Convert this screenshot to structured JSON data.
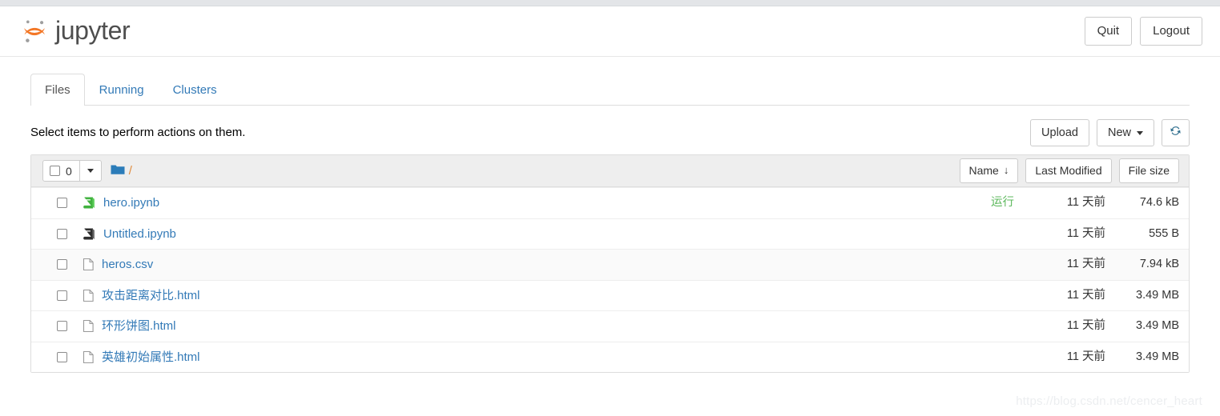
{
  "header": {
    "brand": "jupyter",
    "logo_icon": "jupyter-logo-icon",
    "quit_label": "Quit",
    "logout_label": "Logout"
  },
  "tabs": [
    {
      "label": "Files",
      "active": true
    },
    {
      "label": "Running",
      "active": false
    },
    {
      "label": "Clusters",
      "active": false
    }
  ],
  "action_bar": {
    "select_hint": "Select items to perform actions on them.",
    "upload_label": "Upload",
    "new_label": "New",
    "new_caret_icon": "chevron-down-icon",
    "refresh_icon": "refresh-icon"
  },
  "list_header": {
    "selected_count": "0",
    "select_all_checkbox": "select-all-checkbox",
    "dropdown_caret_icon": "chevron-down-icon",
    "folder_icon": "folder-icon",
    "breadcrumb_path": "/",
    "sort_name": "Name",
    "sort_name_arrow": "↓",
    "sort_last_modified": "Last Modified",
    "sort_file_size": "File size"
  },
  "files": [
    {
      "name": "hero.ipynb",
      "icon": "notebook-icon",
      "icon_state": "running",
      "status": "运行",
      "modified": "11 天前",
      "size": "74.6 kB",
      "striped": false
    },
    {
      "name": "Untitled.ipynb",
      "icon": "notebook-icon",
      "icon_state": "idle",
      "status": "",
      "modified": "11 天前",
      "size": "555 B",
      "striped": false
    },
    {
      "name": "heros.csv",
      "icon": "file-icon",
      "icon_state": "idle",
      "status": "",
      "modified": "11 天前",
      "size": "7.94 kB",
      "striped": true
    },
    {
      "name": "攻击距离对比.html",
      "icon": "file-icon",
      "icon_state": "idle",
      "status": "",
      "modified": "11 天前",
      "size": "3.49 MB",
      "striped": false
    },
    {
      "name": "环形饼图.html",
      "icon": "file-icon",
      "icon_state": "idle",
      "status": "",
      "modified": "11 天前",
      "size": "3.49 MB",
      "striped": false
    },
    {
      "name": "英雄初始属性.html",
      "icon": "file-icon",
      "icon_state": "idle",
      "status": "",
      "modified": "11 天前",
      "size": "3.49 MB",
      "striped": false
    }
  ],
  "watermark": "https://blog.csdn.net/cencer_heart",
  "colors": {
    "link": "#337ab7",
    "running_green": "#5cb85c",
    "jupyter_orange": "#f37726",
    "folder_blue": "#2b7cb9",
    "header_bg": "#eeeeee"
  }
}
